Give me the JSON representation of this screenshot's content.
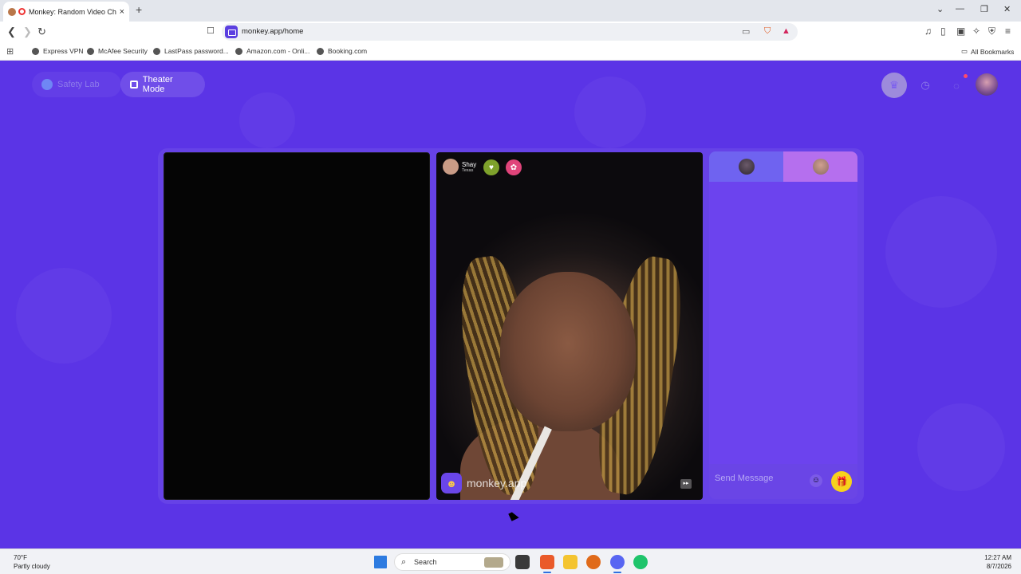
{
  "browser": {
    "tab_title": "Monkey: Random Video Chat",
    "tab_close": "×",
    "new_tab": "+",
    "url": "monkey.app/home",
    "window": {
      "dropdown": "⌄",
      "minimize": "—",
      "restore": "❐",
      "close": "✕"
    },
    "bookmarks": [
      "Express VPN",
      "McAfee Security",
      "LastPass password...",
      "Amazon.com - Onli...",
      "Booking.com"
    ],
    "all_bookmarks": "All Bookmarks"
  },
  "page": {
    "safety_lab": "Safety Lab",
    "theater_mode": "Theater Mode",
    "peer": {
      "name": "Shay",
      "location": "Texas"
    },
    "watermark": "monkey.app",
    "message_placeholder": "Send Message"
  },
  "taskbar": {
    "weather_temp": "70°F",
    "weather_desc": "Partly cloudy",
    "search": "Search",
    "time": "12:27 AM",
    "date": "8/7/2026"
  },
  "icons": {
    "tab_favicon": "monkey-favicon-icon",
    "recording": "recording-icon",
    "crown": "crown-icon",
    "history": "clock-icon",
    "messages": "chat-bubble-icon"
  },
  "colors": {
    "brand": "#5b34e6",
    "gift": "#f7d21c"
  }
}
